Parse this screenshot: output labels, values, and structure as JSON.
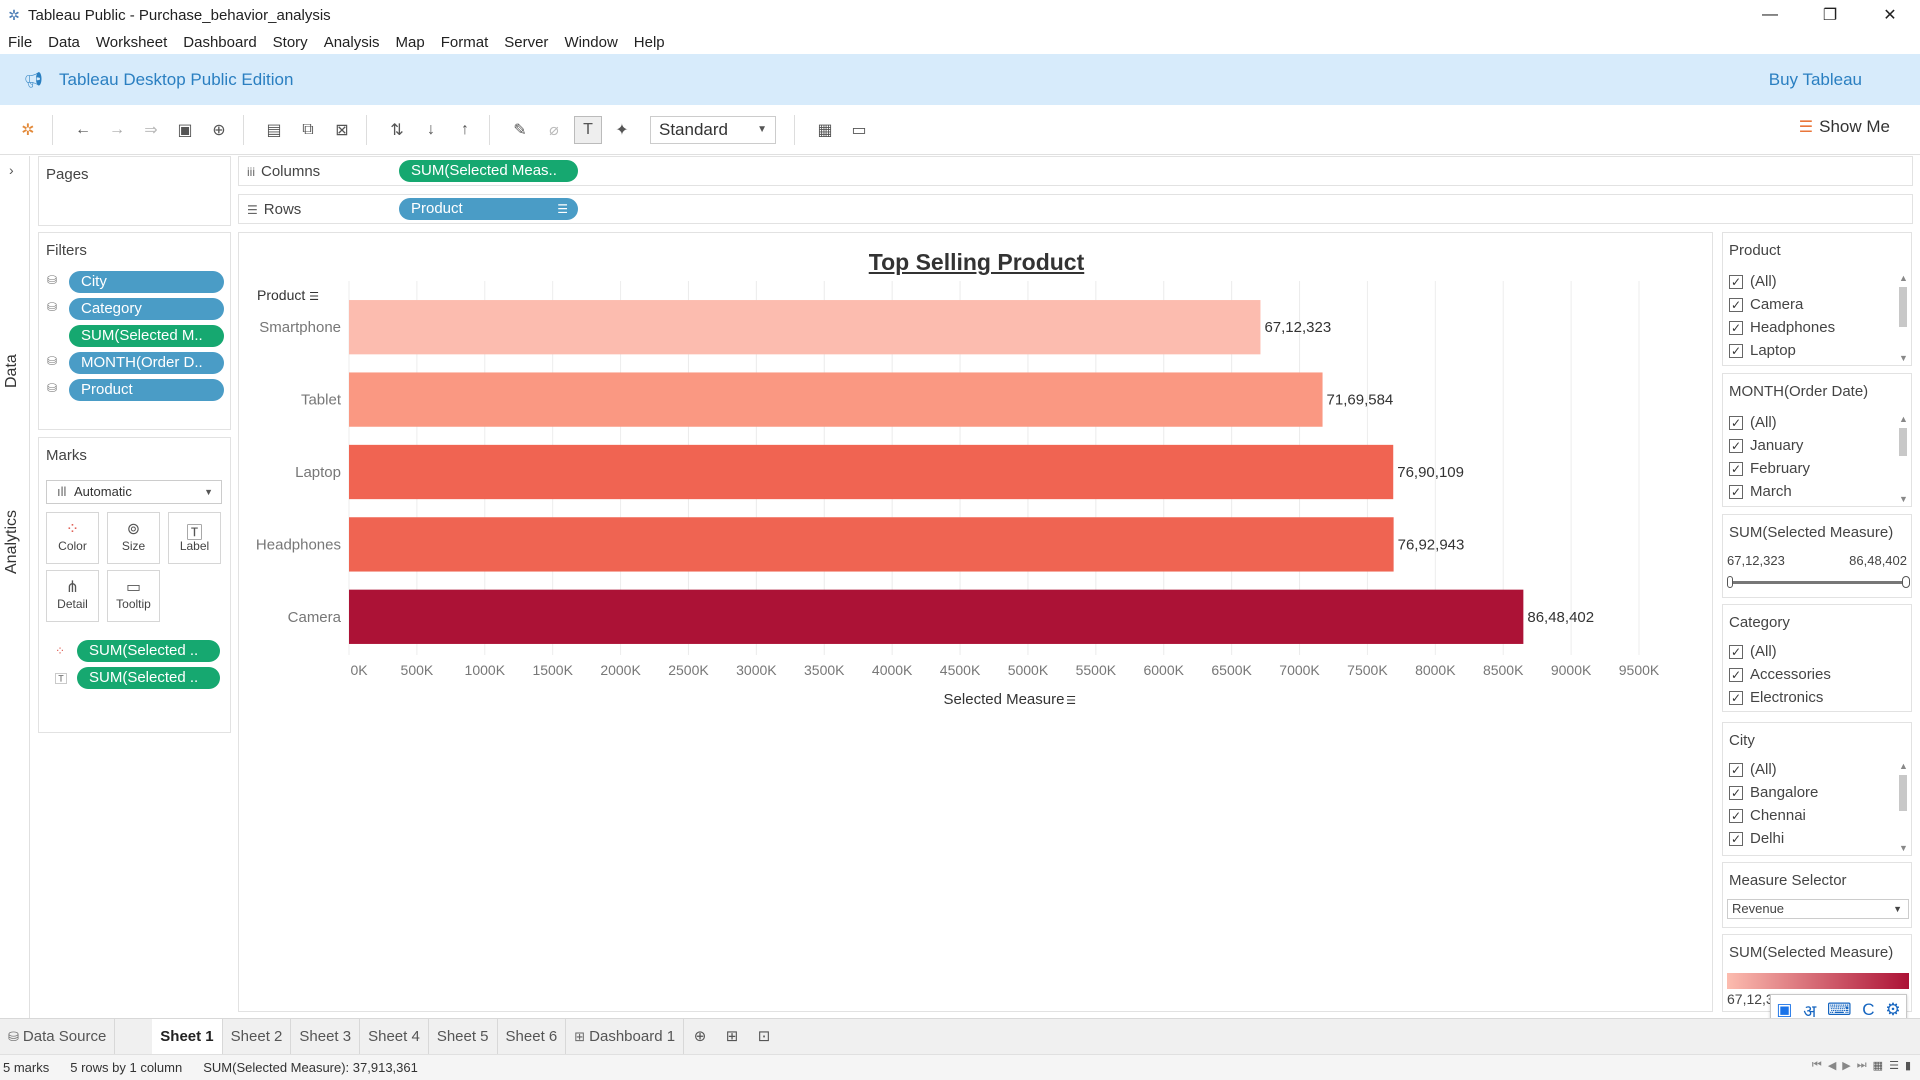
{
  "window": {
    "title": "Tableau Public - Purchase_behavior_analysis",
    "minimize": "—",
    "maximize": "❐",
    "close": "✕"
  },
  "menu": [
    "File",
    "Data",
    "Worksheet",
    "Dashboard",
    "Story",
    "Analysis",
    "Map",
    "Format",
    "Server",
    "Window",
    "Help"
  ],
  "banner": {
    "edition": "Tableau Desktop Public Edition",
    "buy": "Buy Tableau"
  },
  "toolbar": {
    "fit_select": "Standard",
    "show_me": "Show Me"
  },
  "side_tabs": {
    "data": "Data",
    "analytics": "Analytics"
  },
  "pages": {
    "title": "Pages"
  },
  "filters": {
    "title": "Filters",
    "items": [
      "City",
      "Category",
      "SUM(Selected M..",
      "MONTH(Order D..",
      "Product"
    ]
  },
  "marks": {
    "title": "Marks",
    "type": "Automatic",
    "buttons": [
      "Color",
      "Size",
      "Label",
      "Detail",
      "Tooltip"
    ],
    "pills": [
      "SUM(Selected ..",
      "SUM(Selected .."
    ]
  },
  "shelves": {
    "columns_label": "Columns",
    "columns_pill": "SUM(Selected Meas..",
    "rows_label": "Rows",
    "rows_pill": "Product"
  },
  "chart_data": {
    "type": "bar",
    "orientation": "horizontal",
    "title": "Top Selling Product",
    "ylabel": "Product",
    "xlabel": "Selected Measure",
    "categories": [
      "Smartphone",
      "Tablet",
      "Laptop",
      "Headphones",
      "Camera"
    ],
    "values": [
      6712323,
      7169584,
      7690109,
      7692943,
      8648402
    ],
    "value_labels": [
      "67,12,323",
      "71,69,584",
      "76,90,109",
      "76,92,943",
      "86,48,402"
    ],
    "colors": [
      "#fcbcaf",
      "#fa9882",
      "#f06452",
      "#ef6452",
      "#ac1236"
    ],
    "xlim": [
      0,
      9500000
    ],
    "x_ticks": [
      "0K",
      "500K",
      "1000K",
      "1500K",
      "2000K",
      "2500K",
      "3000K",
      "3500K",
      "4000K",
      "4500K",
      "5000K",
      "5500K",
      "6000K",
      "6500K",
      "7000K",
      "7500K",
      "8000K",
      "8500K",
      "9000K",
      "9500K"
    ],
    "grid": "vertical"
  },
  "legends": {
    "product": {
      "title": "Product",
      "items": [
        "(All)",
        "Camera",
        "Headphones",
        "Laptop"
      ]
    },
    "month": {
      "title": "MONTH(Order Date)",
      "items": [
        "(All)",
        "January",
        "February",
        "March"
      ]
    },
    "measure_range": {
      "title": "SUM(Selected Measure)",
      "min": "67,12,323",
      "max": "86,48,402"
    },
    "category": {
      "title": "Category",
      "items": [
        "(All)",
        "Accessories",
        "Electronics"
      ]
    },
    "city": {
      "title": "City",
      "items": [
        "(All)",
        "Bangalore",
        "Chennai",
        "Delhi"
      ]
    },
    "measure_selector": {
      "title": "Measure Selector",
      "value": "Revenue"
    },
    "color_legend": {
      "title": "SUM(Selected Measure)",
      "min_label": "67,12,323",
      "color_start": "#fcbcaf",
      "color_end": "#ac1236"
    }
  },
  "bottom_tabs": {
    "data_source": "Data Source",
    "sheets": [
      "Sheet 1",
      "Sheet 2",
      "Sheet 3",
      "Sheet 4",
      "Sheet 5",
      "Sheet 6"
    ],
    "dashboard": "Dashboard 1"
  },
  "status": {
    "marks": "5 marks",
    "dims": "5 rows by 1 column",
    "sum": "SUM(Selected Measure): 37,913,361"
  },
  "ime": {
    "lang": "अ"
  }
}
